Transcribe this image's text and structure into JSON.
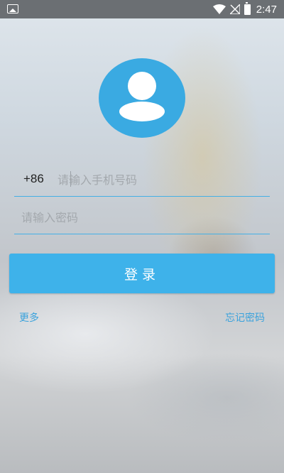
{
  "status_bar": {
    "time": "2:47",
    "icons": [
      "image-icon",
      "wifi-icon",
      "no-signal-icon",
      "battery-charging-icon"
    ]
  },
  "login": {
    "avatar_icon": "user-icon",
    "country_code": "+86",
    "phone_placeholder": "请输入手机号码",
    "password_placeholder": "请输入密码",
    "login_button": "登录",
    "more_link": "更多",
    "forgot_link": "忘记密码"
  },
  "colors": {
    "accent": "#3eb2ea",
    "link": "#3aa2dc",
    "divider": "#44b0e6"
  }
}
